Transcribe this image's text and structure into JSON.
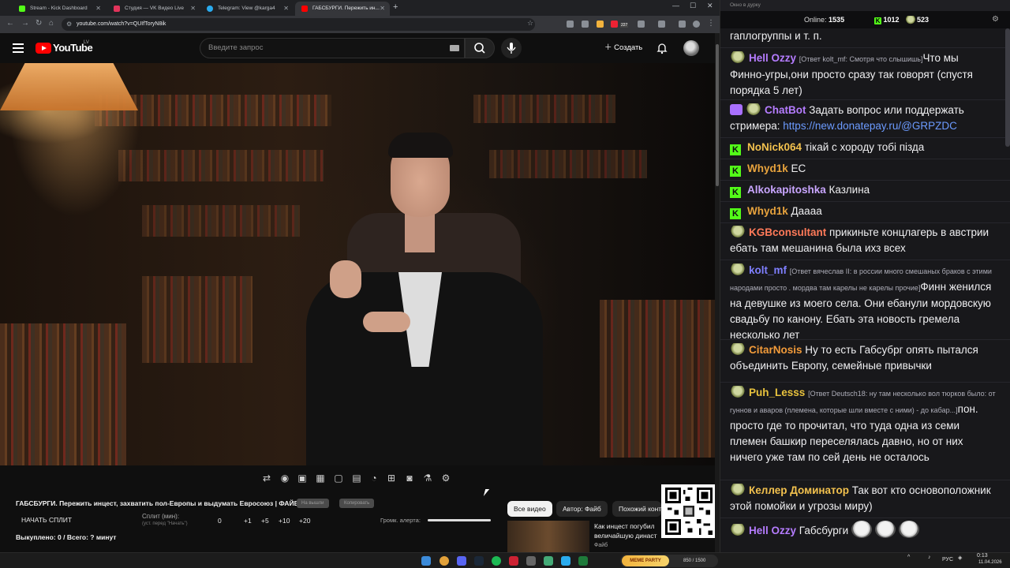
{
  "browser": {
    "tabs": [
      {
        "label": "Stream - Kick Dashboard",
        "color": "#53fc18"
      },
      {
        "label": "Студия — VK Видео Live",
        "color": "#e2345b"
      },
      {
        "label": "Telegram: View @karga4",
        "color": "#2aabee"
      },
      {
        "label": "ГАБСБУРГИ. Пережить ин...",
        "color": "#ff0000"
      }
    ],
    "url": "youtube.com/watch?v=QUIfToryN8ik",
    "ext_badge": "227"
  },
  "youtube": {
    "logo_text": "YouTube",
    "country": "LV",
    "search_placeholder": "Введите запрос",
    "create_label": "Создать",
    "video_title": "ГАБСБУРГИ. Пережить инцест, захватить пол-Европы и выдумать Евросоюз | ФАЙБ",
    "pill_1": "На вышли",
    "pill_2": "Копировать",
    "split": {
      "start_label": "НАЧАТЬ СПЛИТ",
      "split_label": "Сплит (мин):",
      "split_hint": "(уст. перед \"Начать\")",
      "value": "0",
      "increments": [
        "+1",
        "+5",
        "+10",
        "+20"
      ]
    },
    "alert_label": "Громк. алерта:",
    "alert_volume": 1.0,
    "done_text": "Выкуплено: 0 / Всего: ? минут",
    "chips": [
      "Все видео",
      "Автор: Файб",
      "Похожий конт"
    ],
    "related": {
      "title": "Как инцест погубил величайшую династ",
      "channel": "Файб"
    }
  },
  "chat": {
    "window_title": "Окно в дурку",
    "online_label": "Online:",
    "online_count": "1535",
    "kick_count": "1012",
    "other_count": "523",
    "messages": [
      {
        "user": "",
        "color": "#efeff1",
        "badge": "none",
        "reply": "",
        "text": "гаплогруппы и т. п."
      },
      {
        "user": "Hell Ozzy",
        "color": "#b57cff",
        "badge": "avatar",
        "reply": "[Ответ kolt_mf: Смотря что слышишь]",
        "text": "Что мы Финно-угры,они просто сразу так говорят (спустя порядка 5 лет)"
      },
      {
        "user": "ChatBot",
        "color": "#b57cff",
        "badge": "bot",
        "reply": "",
        "text": "Задать вопрос или поддержать стримера: ",
        "link": "https://new.donatepay.ru/@GRPZDC"
      },
      {
        "user": "NoNick064",
        "color": "#f2c14e",
        "badge": "kick",
        "reply": "",
        "text": "тікай с хороду тобі пізда"
      },
      {
        "user": "Whyd1k",
        "color": "#e8a33d",
        "badge": "kick",
        "reply": "",
        "text": "ЕС"
      },
      {
        "user": "Alkokapitoshka",
        "color": "#c9a6ff",
        "badge": "kick",
        "reply": "",
        "text": "Казлина"
      },
      {
        "user": "Whyd1k",
        "color": "#e8a33d",
        "badge": "kick",
        "reply": "",
        "text": "Даааа"
      },
      {
        "user": "KGBconsultant",
        "color": "#ff7a59",
        "badge": "avatar",
        "reply": "",
        "text": "прикиньте концлагерь в австрии ебать там мешанина была ихз всех"
      },
      {
        "user": "kolt_mf",
        "color": "#7f7fff",
        "badge": "avatar",
        "reply": "[Ответ вячеслав II: в россии много смешаных браков с этими народами просто . мордва там карелы не карелы прочие]",
        "text": "Финн женился на девушке из моего села. Они ебанули мордовскую свадьбу по канону. Ебать эта новость гремела несколько лет"
      },
      {
        "user": "CitarNosis",
        "color": "#f29b3a",
        "badge": "avatar",
        "reply": "",
        "text": "Ну то есть Габсубрг опять пытался объединить Европу, семейные привычки"
      },
      {
        "user": "Puh_Lesss",
        "color": "#e8c23d",
        "badge": "avatar",
        "reply": "[Ответ Deutsch18: ну там несколько вол тюрков было: от гуннов и аваров (племена, которые шли вместе с ними) - до кабар...]",
        "text": "пон. просто где то прочитал, что туда одна из семи племен башкир переселялась давно, но от них ничего уже там по сей день не осталось"
      },
      {
        "user": "Келлер Доминатор",
        "color": "#f2c14e",
        "badge": "avatar",
        "reply": "",
        "text": "Так вот кто основоположник этой помойки и угрозы миру)"
      },
      {
        "user": "Hell Ozzy",
        "color": "#b57cff",
        "badge": "avatar",
        "reply": "",
        "text": "Габсбурги"
      }
    ]
  },
  "taskbar": {
    "meme_label": "MEME PARTY",
    "meme_count": "850 / 1500",
    "lang": "РУС",
    "time": "0:13",
    "date": "11.04.2026"
  }
}
